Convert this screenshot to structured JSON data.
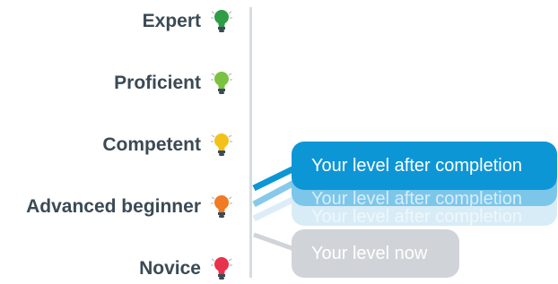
{
  "levels": [
    {
      "label": "Expert",
      "bulb_color": "#2e9d46",
      "icon": "lightbulb-icon"
    },
    {
      "label": "Proficient",
      "bulb_color": "#7cc242",
      "icon": "lightbulb-icon"
    },
    {
      "label": "Competent",
      "bulb_color": "#f3c21a",
      "icon": "lightbulb-icon"
    },
    {
      "label": "Advanced beginner",
      "bulb_color": "#ef7b22",
      "icon": "lightbulb-icon"
    },
    {
      "label": "Novice",
      "bulb_color": "#e8314a",
      "icon": "lightbulb-icon"
    }
  ],
  "callouts": {
    "after_completion": {
      "label": "Your level after completion",
      "color": "#0d96d6"
    },
    "now": {
      "label": "Your level now",
      "color": "#d0d4d8"
    }
  },
  "colors": {
    "axis": "#d6dde1",
    "label_text": "#3b4a55"
  }
}
